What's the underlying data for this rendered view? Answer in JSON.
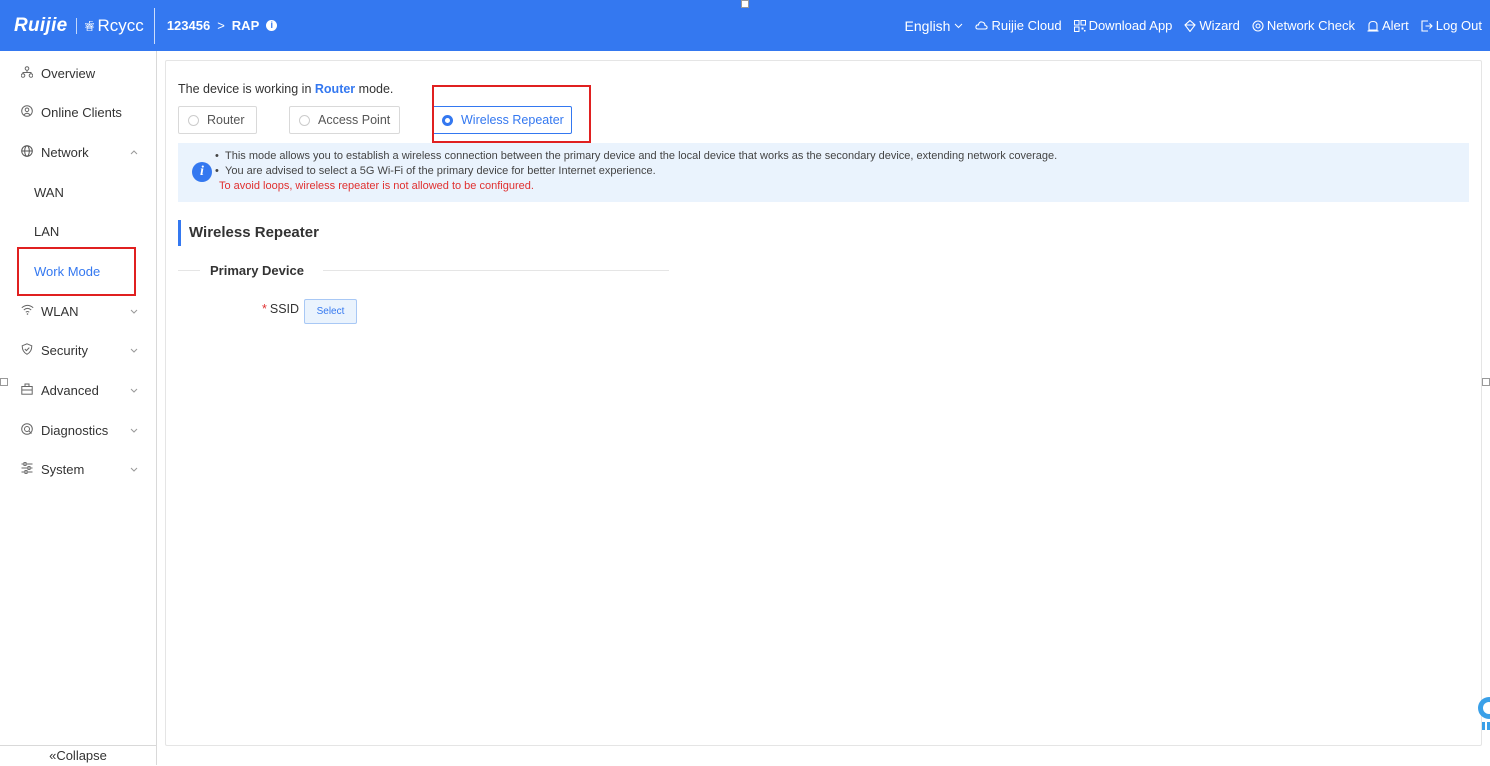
{
  "topbar": {
    "brand_ruijie": "Ruijie",
    "brand_rcycc": "Rcycc",
    "brand_rcycc_prefix": "睿",
    "device_name": "123456",
    "breadcrumb_sep": ">",
    "device_mode": "RAP",
    "language": "English",
    "items": [
      {
        "label": "Ruijie Cloud",
        "icon": "cloud-icon"
      },
      {
        "label": "Download App",
        "icon": "qr-code-icon"
      },
      {
        "label": "Wizard",
        "icon": "wizard-icon"
      },
      {
        "label": "Network Check",
        "icon": "network-check-icon"
      },
      {
        "label": "Alert",
        "icon": "alert-icon"
      },
      {
        "label": "Log Out",
        "icon": "logout-icon"
      }
    ]
  },
  "sidebar": {
    "items": [
      {
        "label": "Overview",
        "icon": "overview-icon"
      },
      {
        "label": "Online Clients",
        "icon": "clients-icon"
      },
      {
        "label": "Network",
        "icon": "globe-icon"
      },
      {
        "label": "WAN"
      },
      {
        "label": "LAN"
      },
      {
        "label": "Work Mode"
      },
      {
        "label": "WLAN",
        "icon": "wifi-icon"
      },
      {
        "label": "Security",
        "icon": "shield-icon"
      },
      {
        "label": "Advanced",
        "icon": "advanced-icon"
      },
      {
        "label": "Diagnostics",
        "icon": "diagnostics-icon"
      },
      {
        "label": "System",
        "icon": "system-icon"
      }
    ],
    "collapse_label": "Collapse"
  },
  "main": {
    "mode_prefix": "The device is working in",
    "current_mode": "Router",
    "mode_suffix": "mode.",
    "modes": [
      {
        "label": "Router",
        "selected": false
      },
      {
        "label": "Access Point",
        "selected": false
      },
      {
        "label": "Wireless Repeater",
        "selected": true
      }
    ],
    "info_lines": [
      "This mode allows you to establish a wireless connection between the primary device and the local device that works as the secondary device, extending network coverage.",
      "You are advised to select a 5G Wi-Fi of the primary device for better Internet experience."
    ],
    "info_warning": "To avoid loops, wireless repeater is not allowed to be configured.",
    "section_title": "Wireless Repeater",
    "sub_title": "Primary Device",
    "ssid_label": "SSID",
    "ssid_required": "*",
    "select_label": "Select"
  },
  "colors": {
    "accent": "#3478f0",
    "highlight_box": "#e02020",
    "warning_text": "#e03030"
  }
}
